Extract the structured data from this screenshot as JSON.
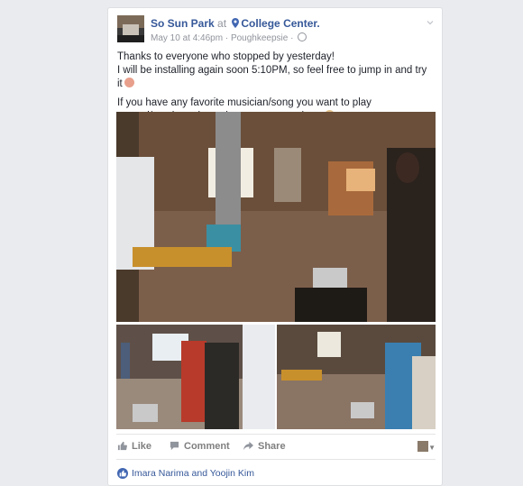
{
  "post": {
    "author": "So Sun Park",
    "at_word": "at",
    "place": "College Center.",
    "date": "May 10 at 4:46pm",
    "separator": "·",
    "location": "Poughkeepsie",
    "paragraph1_line1": "Thanks to everyone who stopped by yesterday!",
    "paragraph1_line2": "I will be installing again soon 5:10PM, so feel free to jump in and try it",
    "paragraph2": "If you have any favorite musician/song you want to play around/mash up, leave it as a comment here"
  },
  "actions": {
    "like": "Like",
    "comment": "Comment",
    "share": "Share"
  },
  "reactions": {
    "names": "Imara Narima and Yoojin Kim"
  },
  "colors": {
    "link": "#365899",
    "background": "#e9ebee",
    "like_blue": "#4267b2"
  },
  "icons": [
    "map-pin-icon",
    "globe-icon",
    "chevron-down-icon",
    "heart-emoji-icon",
    "smile-emoji-icon",
    "like-icon",
    "comment-icon",
    "share-icon",
    "like-badge-icon"
  ]
}
